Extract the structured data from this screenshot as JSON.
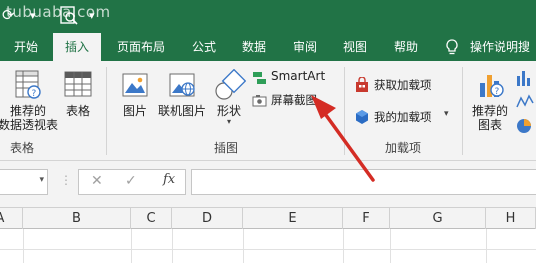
{
  "watermark": "tubuaba.com",
  "tabs": [
    {
      "label": "开始",
      "active": false
    },
    {
      "label": "插入",
      "active": true
    },
    {
      "label": "页面布局",
      "active": false
    },
    {
      "label": "公式",
      "active": false
    },
    {
      "label": "数据",
      "active": false
    },
    {
      "label": "审阅",
      "active": false
    },
    {
      "label": "视图",
      "active": false
    },
    {
      "label": "帮助",
      "active": false
    },
    {
      "label": "操作说明搜",
      "active": false
    }
  ],
  "ribbon": {
    "tables_group": {
      "label": "表格",
      "pivot_label_1": "推荐的",
      "pivot_label_2": "数据透视表",
      "table_label": "表格"
    },
    "illustrations_group": {
      "label": "插图",
      "picture_label": "图片",
      "online_picture_label": "联机图片",
      "shapes_label": "形状",
      "smartart_label": "SmartArt",
      "screenshot_label": "屏幕截图"
    },
    "addins_group": {
      "label": "加载项",
      "get_addins_label": "获取加载项",
      "my_addins_label": "我的加载项"
    },
    "charts_group": {
      "recommended_label_1": "推荐的",
      "recommended_label_2": "图表"
    }
  },
  "formula_bar": {
    "name_value": "",
    "formula_value": "",
    "fx_label": "fx"
  },
  "columns": [
    "A",
    "B",
    "C",
    "D",
    "E",
    "F",
    "G",
    "H"
  ],
  "colors": {
    "accent": "#217346",
    "arrow": "#d42c24"
  }
}
